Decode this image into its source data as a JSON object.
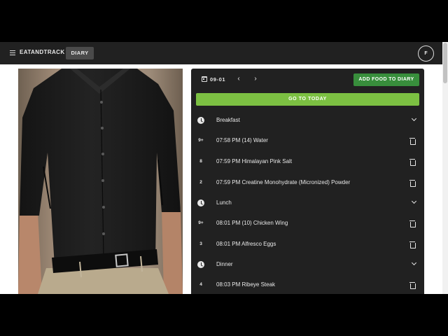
{
  "appbar": {
    "brand": "EATANDTRACK",
    "diary_tab": "DIARY",
    "avatar_initial": "F",
    "menu_icon": "hamburger-menu-icon"
  },
  "toolbar": {
    "date": "09-01",
    "calendar_icon": "calendar-icon",
    "prev_icon": "chevron-left-icon",
    "next_icon": "chevron-right-icon",
    "add_food_label": "ADD FOOD TO DIARY",
    "go_today_label": "GO TO TODAY"
  },
  "meals": [
    {
      "name": "Breakfast",
      "entries": [
        {
          "qty": "9+",
          "text": "07:58 PM (14) Water"
        },
        {
          "qty": "8",
          "text": "07:59 PM Himalayan Pink Salt"
        },
        {
          "qty": "2",
          "text": "07:59 PM Creatine Monohydrate (Micronized) Powder"
        }
      ]
    },
    {
      "name": "Lunch",
      "entries": [
        {
          "qty": "9+",
          "text": "08:01 PM (10) Chicken Wing"
        },
        {
          "qty": "3",
          "text": "08:01 PM Alfresco Eggs"
        }
      ]
    },
    {
      "name": "Dinner",
      "entries": [
        {
          "qty": "4",
          "text": "08:03 PM Ribeye Steak"
        }
      ]
    }
  ],
  "colors": {
    "appbar_bg": "#212121",
    "panel_bg": "#212121",
    "add_button": "#388e3c",
    "today_button": "#7cc042"
  }
}
